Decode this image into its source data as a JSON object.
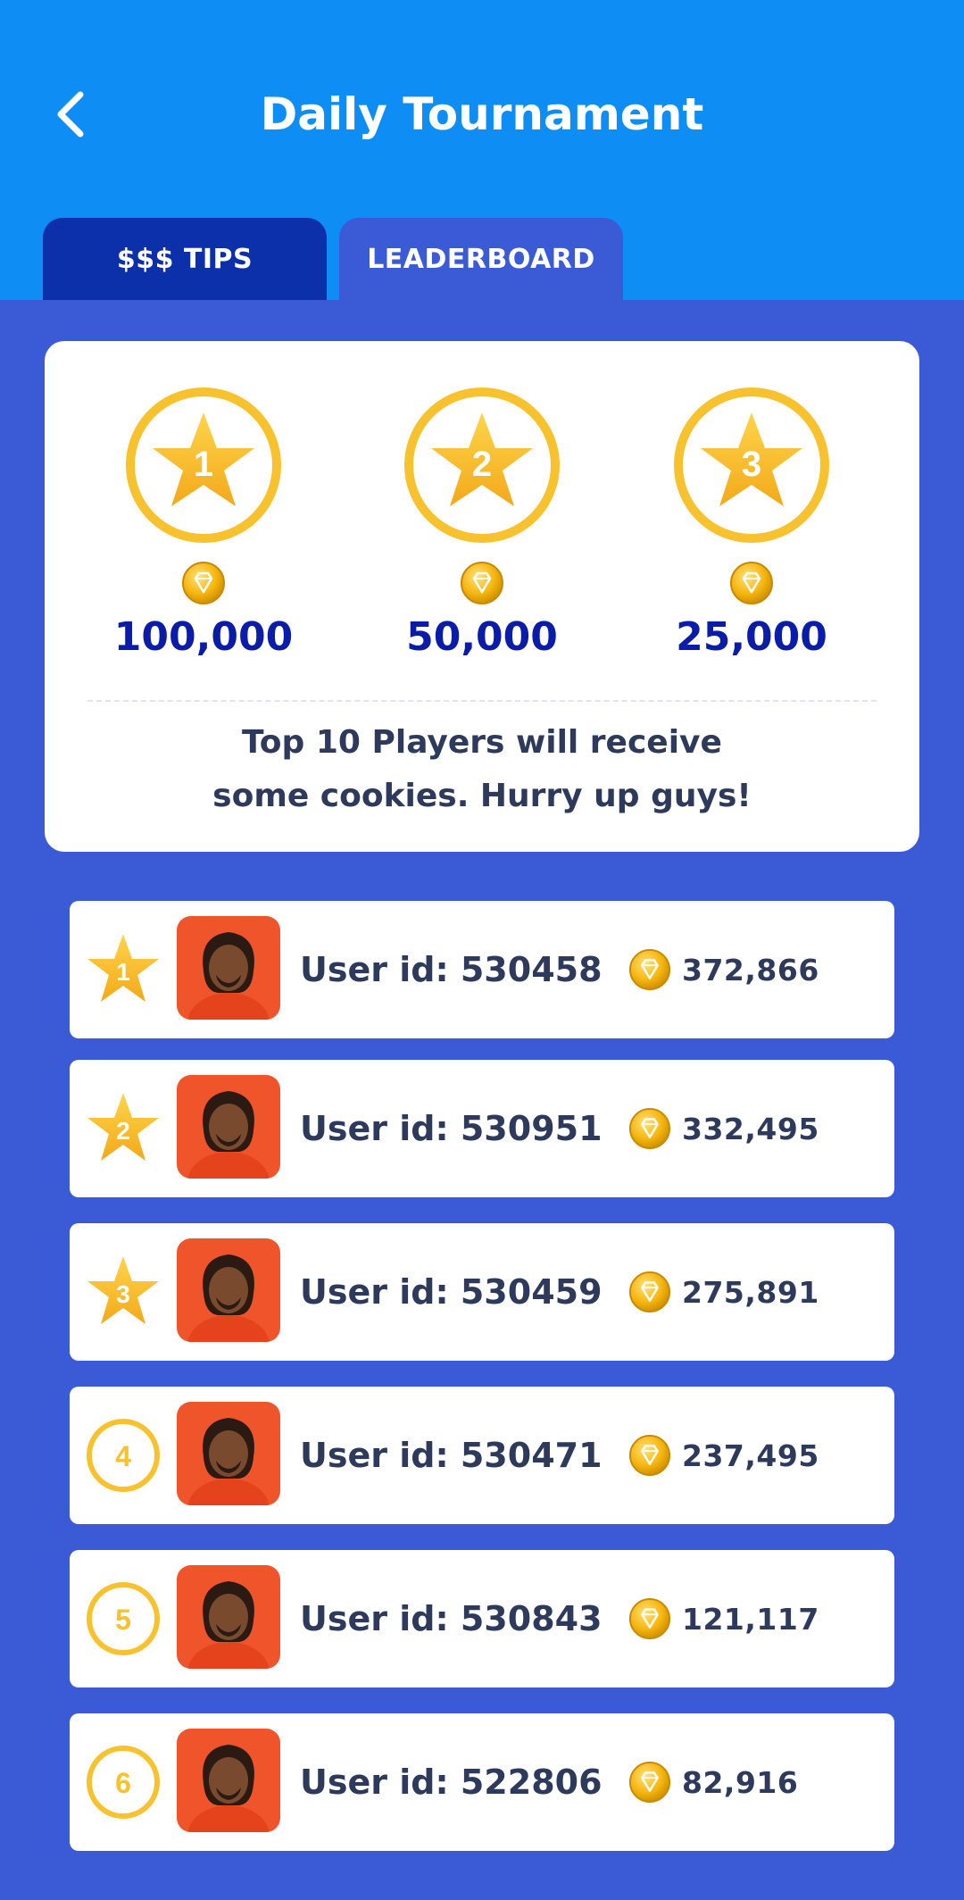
{
  "header": {
    "title": "Daily Tournament",
    "back_icon": "chevron-left-icon",
    "background": "#0E8DF5"
  },
  "tabs": [
    {
      "label": "$$$ TIPS",
      "active": false
    },
    {
      "label": "LEADERBOARD",
      "active": true
    }
  ],
  "prizes": [
    {
      "rank": "1",
      "amount": "100,000"
    },
    {
      "rank": "2",
      "amount": "50,000"
    },
    {
      "rank": "3",
      "amount": "25,000"
    }
  ],
  "note": {
    "line1": "Top 10 Players will receive",
    "line2": "some cookies. Hurry up guys!"
  },
  "leaderboard": [
    {
      "rank": "1",
      "badge": "star",
      "user": "User id: 530458",
      "score": "372,866"
    },
    {
      "rank": "2",
      "badge": "star",
      "user": "User id: 530951",
      "score": "332,495"
    },
    {
      "rank": "3",
      "badge": "star",
      "user": "User id: 530459",
      "score": "275,891"
    },
    {
      "rank": "4",
      "badge": "circle",
      "user": "User id: 530471",
      "score": "237,495"
    },
    {
      "rank": "5",
      "badge": "circle",
      "user": "User id: 530843",
      "score": "121,117"
    },
    {
      "rank": "6",
      "badge": "circle",
      "user": "User id: 522806",
      "score": "82,916"
    }
  ],
  "colors": {
    "accent_gold": "#F8C22E",
    "page_bg": "#3B5BD6",
    "tab_dark": "#0C2FAA",
    "prize_text": "#0A1CA8",
    "text_dark": "#2E3A5C",
    "avatar_bg": "#F0542A"
  }
}
